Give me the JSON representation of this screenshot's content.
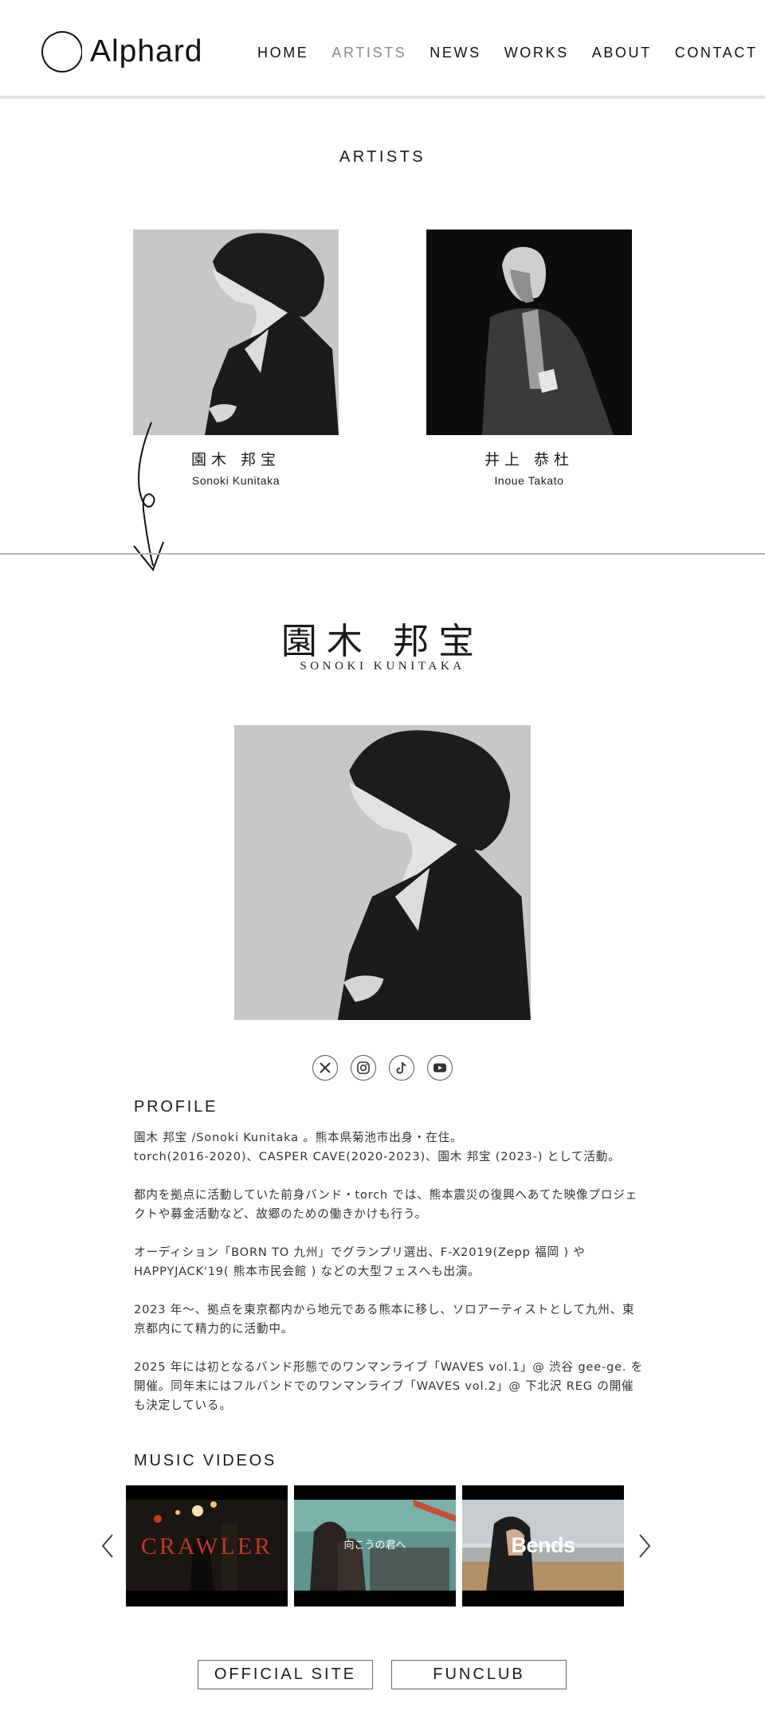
{
  "header": {
    "logo_text": "Alphard",
    "nav": [
      "HOME",
      "ARTISTS",
      "NEWS",
      "WORKS",
      "ABOUT",
      "CONTACT"
    ]
  },
  "artists_section": {
    "title": "ARTISTS",
    "artists": [
      {
        "name_jp": "園木 邦宝",
        "name_en": "Sonoki Kunitaka"
      },
      {
        "name_jp": "井上 恭杜",
        "name_en": "Inoue Takato"
      }
    ]
  },
  "detail": {
    "name_jp": "園木 邦宝",
    "name_en": "SONOKI KUNITAKA",
    "social_icons": [
      "x-icon",
      "instagram-icon",
      "tiktok-icon",
      "youtube-icon"
    ],
    "profile_title": "PROFILE",
    "profile": [
      "園木 邦宝 /Sonoki Kunitaka 。熊本県菊池市出身・在住。\ntorch(2016-2020)、CASPER CAVE(2020-2023)、園木 邦宝 (2023-) として活動。",
      "都内を拠点に活動していた前身バンド・torch では、熊本震災の復興へあてた映像プロジェクトや募金活動など、故郷のための働きかけも行う。",
      "オーディション「BORN TO 九州」でグランプリ選出、F-X2019(Zepp 福岡 ) や HAPPYJACK'19( 熊本市民会館 ) などの大型フェスへも出演。",
      "2023 年〜、拠点を東京都内から地元である熊本に移し、ソロアーティストとして九州、東京都内にて精力的に活動中。",
      "2025 年には初となるバンド形態でのワンマンライブ「WAVES vol.1」@ 渋谷 gee-ge. を開催。同年末にはフルバンドでのワンマンライブ「WAVES vol.2」@ 下北沢 REG の開催も決定している。"
    ],
    "mv_title": "MUSIC VIDEOS",
    "videos": [
      {
        "title": "CRAWLER"
      },
      {
        "title": "向こうの君へ"
      },
      {
        "title": "Bends"
      }
    ],
    "buttons": {
      "official": "OFFICIAL SITE",
      "fanclub": "FUNCLUB"
    }
  },
  "colors": {
    "text": "#1a1a1a",
    "nav_active": "#8a8a8a",
    "divider": "#b5b5b5",
    "mv_crawler": "#c0392b"
  }
}
